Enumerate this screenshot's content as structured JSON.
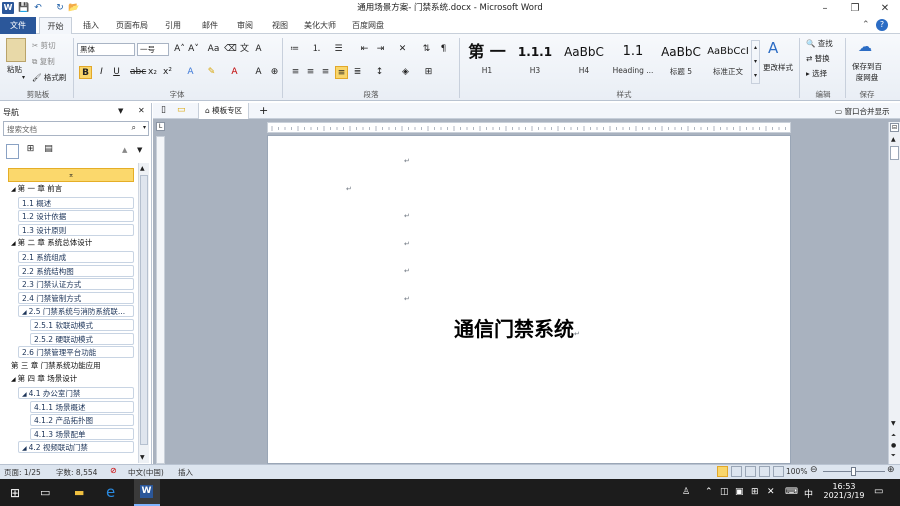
{
  "window": {
    "title": "通用场景方案- 门禁系统.docx - Microsoft Word"
  },
  "quick_access": {
    "save": "💾",
    "undo": "↶",
    "redo": "↻",
    "open": "📂"
  },
  "window_controls": {
    "minimize": "–",
    "restore": "❐",
    "close": "✕",
    "help": "?"
  },
  "tabs": [
    "文件",
    "开始",
    "插入",
    "页面布局",
    "引用",
    "邮件",
    "审阅",
    "视图",
    "美化大师",
    "百度网盘"
  ],
  "ribbon": {
    "clipboard": {
      "paste": "粘贴",
      "cut": "剪切",
      "copy": "复制",
      "format_painter": "格式刷",
      "group": "剪贴板"
    },
    "font": {
      "family": "黑体",
      "size": "一号",
      "group": "字体"
    },
    "paragraph": {
      "group": "段落"
    },
    "styles": {
      "group": "样式",
      "items": [
        {
          "preview": "第 一",
          "label": "H1"
        },
        {
          "preview": "1.1.1",
          "label": "H3"
        },
        {
          "preview": "AaBbC",
          "label": "H4"
        },
        {
          "preview": "1.1",
          "label": "Heading ..."
        },
        {
          "preview": "AaBbC",
          "label": "标题 5"
        },
        {
          "preview": "AaBbCcI",
          "label": "标准正文"
        }
      ],
      "change": "更改样式"
    },
    "editing": {
      "find": "查找",
      "replace": "替换",
      "select": "选择",
      "group": "编辑"
    },
    "save": {
      "label_line1": "保存到百",
      "label_line2": "度网盘",
      "group": "保存"
    }
  },
  "nav": {
    "title": "导航",
    "search_placeholder": "搜索文档",
    "items": [
      {
        "text": "第 一 章 前言",
        "level": 1,
        "arrow": "◢"
      },
      {
        "text": "1.1 概述",
        "level": 2
      },
      {
        "text": "1.2 设计依据",
        "level": 2
      },
      {
        "text": "1.3 设计原则",
        "level": 2
      },
      {
        "text": "第 二 章 系统总体设计",
        "level": 1,
        "arrow": "◢"
      },
      {
        "text": "2.1 系统组成",
        "level": 2
      },
      {
        "text": "2.2 系统结构图",
        "level": 2
      },
      {
        "text": "2.3 门禁认证方式",
        "level": 2
      },
      {
        "text": "2.4 门禁管制方式",
        "level": 2
      },
      {
        "text": "2.5 门禁系统与消防系统联...",
        "level": 2,
        "arrow": "◢"
      },
      {
        "text": "2.5.1 软联动模式",
        "level": 3
      },
      {
        "text": "2.5.2 硬联动模式",
        "level": 3
      },
      {
        "text": "2.6 门禁管理平台功能",
        "level": 2
      },
      {
        "text": "第 三 章 门禁系统功能应用",
        "level": 1
      },
      {
        "text": "第 四 章 场景设计",
        "level": 1,
        "arrow": "◢"
      },
      {
        "text": "4.1 办公室门禁",
        "level": 2,
        "arrow": "◢"
      },
      {
        "text": "4.1.1 场景概述",
        "level": 3
      },
      {
        "text": "4.1.2 产品拓扑图",
        "level": 3
      },
      {
        "text": "4.1.3 场景配单",
        "level": 3
      },
      {
        "text": "4.2 视频联动门禁",
        "level": 2,
        "arrow": "◢"
      }
    ]
  },
  "doc_tab": {
    "template_zone": "模板专区",
    "window_split": "窗口合并显示"
  },
  "document": {
    "title": "通信门禁系统",
    "para_mark": "↵"
  },
  "status": {
    "page": "页面: 1/25",
    "words": "字数: 8,554",
    "lang": "中文(中国)",
    "mode": "插入",
    "zoom": "100%"
  },
  "taskbar": {
    "time": "16:53",
    "date": "2021/3/19",
    "ime": "中",
    "keyboard": "⌨"
  }
}
